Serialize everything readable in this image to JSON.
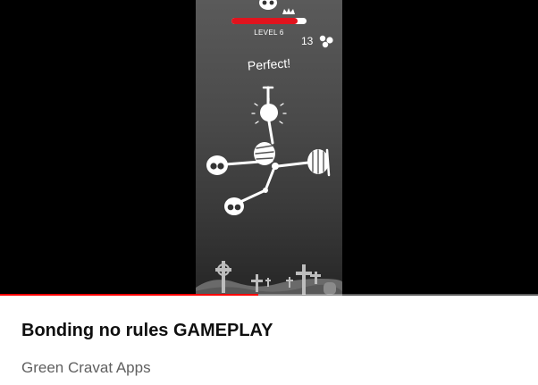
{
  "video": {
    "progress_fraction": 0.48,
    "progress_color": "#ff0000",
    "game": {
      "level_label": "LEVEL 6",
      "counter": "13",
      "counter_icon": "bones-icon",
      "level_progress_fraction": 0.88,
      "bar_color": "#e0141e",
      "feedback_text": "Perfect!",
      "top_icons": [
        "skull-icon",
        "crown-icon"
      ]
    }
  },
  "info": {
    "title": "Bonding no rules GAMEPLAY",
    "channel": "Green Cravat Apps"
  }
}
